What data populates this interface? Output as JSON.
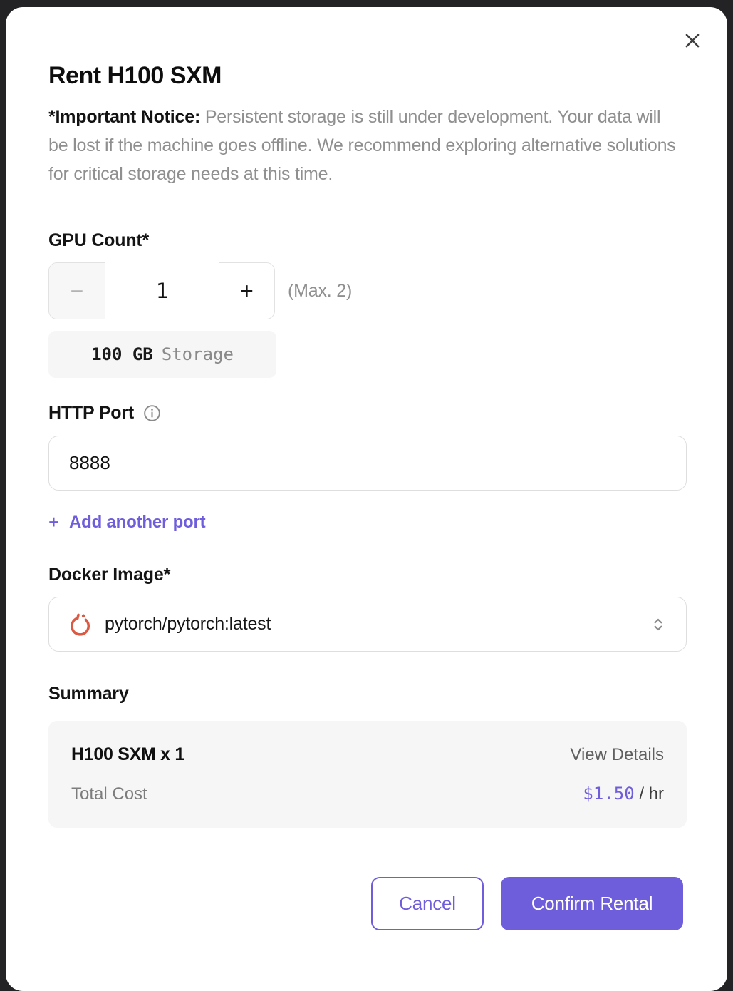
{
  "modal": {
    "title": "Rent H100 SXM",
    "notice": {
      "bold": "*Important Notice:",
      "text": " Persistent storage is still under development. Your data will be lost if the machine goes offline. We recommend exploring alternative solutions for critical storage needs at this time."
    },
    "gpu_count": {
      "label": "GPU Count*",
      "decrement": "−",
      "value": "1",
      "increment": "+",
      "max_note": "(Max. 2)",
      "storage_value": "100 GB",
      "storage_unit": "Storage"
    },
    "http_port": {
      "label": "HTTP Port",
      "value": "8888",
      "add_plus": "+",
      "add_label": "Add another port"
    },
    "docker_image": {
      "label": "Docker Image*",
      "value": "pytorch/pytorch:latest"
    },
    "summary": {
      "label": "Summary",
      "item_name": "H100 SXM x 1",
      "view_details": "View Details",
      "total_cost_label": "Total Cost",
      "price": "$1.50",
      "price_unit": " / hr"
    },
    "actions": {
      "cancel": "Cancel",
      "confirm": "Confirm Rental"
    }
  },
  "colors": {
    "accent": "#6e5edb",
    "pytorch": "#dc5a43"
  }
}
